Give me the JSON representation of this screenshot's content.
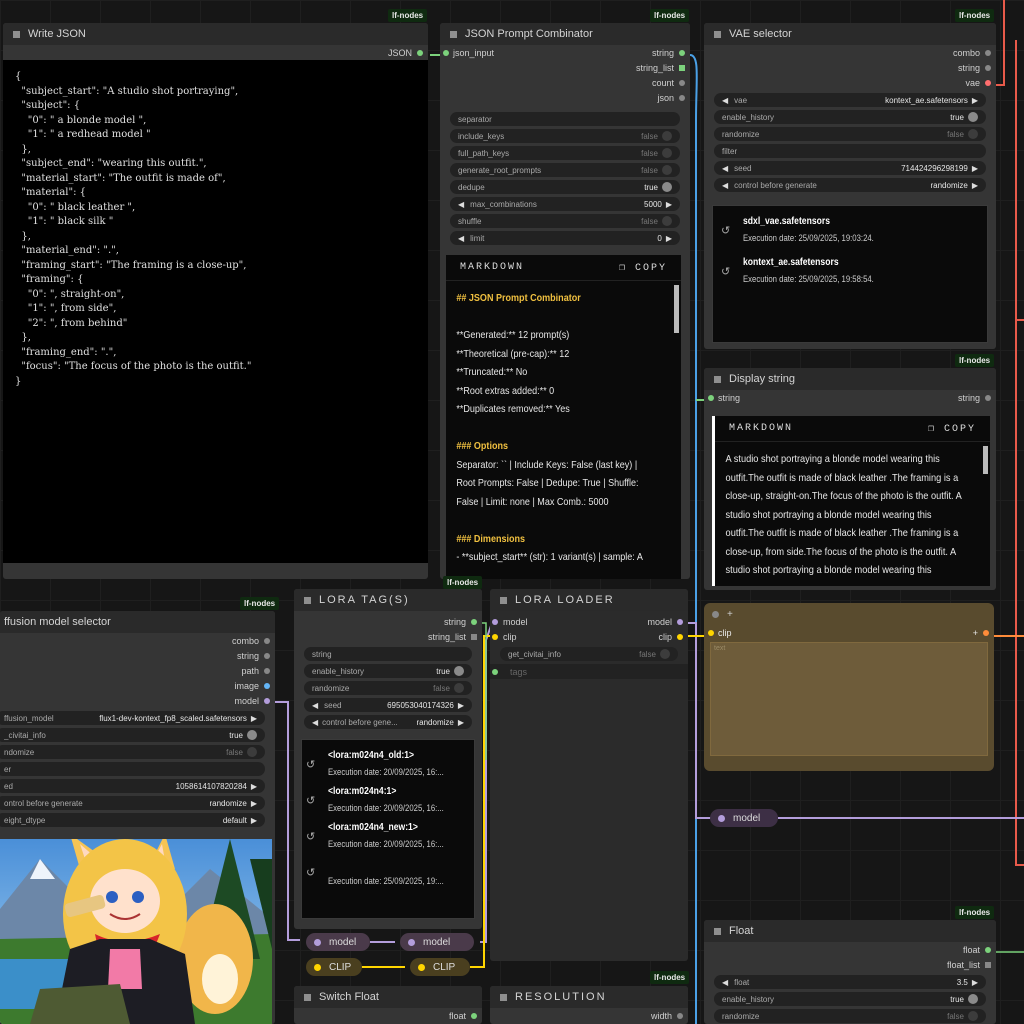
{
  "badge": "lf-nodes",
  "write_json": {
    "title": "Write JSON",
    "output": "JSON",
    "code": "{\n  \"subject_start\": \"A studio shot portraying\",\n  \"subject\": {\n    \"0\": \" a blonde model \",\n    \"1\": \" a redhead model \"\n  },\n  \"subject_end\": \"wearing this outfit.\",\n  \"material_start\": \"The outfit is made of\",\n  \"material\": {\n    \"0\": \" black leather \",\n    \"1\": \" black silk \"\n  },\n  \"material_end\": \".\",\n  \"framing_start\": \"The framing is a close-up\",\n  \"framing\": {\n    \"0\": \", straight-on\",\n    \"1\": \", from side\",\n    \"2\": \", from behind\"\n  },\n  \"framing_end\": \".\",\n  \"focus\": \"The focus of the photo is the outfit.\"\n}"
  },
  "combinator": {
    "title": "JSON Prompt Combinator",
    "input": "json_input",
    "outputs": [
      "string",
      "string_list",
      "count",
      "json"
    ],
    "widgets": [
      {
        "label": "separator",
        "value": ""
      },
      {
        "label": "include_keys",
        "value": "false"
      },
      {
        "label": "full_path_keys",
        "value": "false"
      },
      {
        "label": "generate_root_prompts",
        "value": "false"
      },
      {
        "label": "dedupe",
        "value": "true"
      },
      {
        "label": "max_combinations",
        "value": "5000"
      },
      {
        "label": "shuffle",
        "value": "false"
      },
      {
        "label": "limit",
        "value": "0"
      }
    ],
    "md_label": "MARKDOWN",
    "copy": "COPY",
    "md_lines": [
      "## JSON Prompt Combinator",
      "",
      "**Generated:** 12 prompt(s)",
      "**Theoretical (pre-cap):** 12",
      "**Truncated:** No",
      "**Root extras added:** 0",
      "**Duplicates removed:** Yes",
      "",
      "### Options",
      "Separator: `` | Include Keys: False (last key) |",
      "Root Prompts: False | Dedupe: True | Shuffle:",
      "False | Limit: none | Max Comb.: 5000",
      "",
      "### Dimensions",
      "- **subject_start** (str): 1 variant(s) | sample: A"
    ]
  },
  "vae": {
    "title": "VAE selector",
    "outputs": [
      "combo",
      "string",
      "vae"
    ],
    "widgets": [
      {
        "label": "vae",
        "value": "kontext_ae.safetensors"
      },
      {
        "label": "enable_history",
        "value": "true"
      },
      {
        "label": "randomize",
        "value": "false"
      },
      {
        "label": "filter",
        "value": ""
      },
      {
        "label": "seed",
        "value": "714424296298199"
      },
      {
        "label": "control before generate",
        "value": "randomize"
      }
    ],
    "history": [
      {
        "name": "sdxl_vae.safetensors",
        "date": "Execution date: 25/09/2025, 19:03:24."
      },
      {
        "name": "kontext_ae.safetensors",
        "date": "Execution date: 25/09/2025, 19:58:54."
      }
    ]
  },
  "display": {
    "title": "Display string",
    "input": "string",
    "output": "string",
    "md_label": "MARKDOWN",
    "copy": "COPY",
    "text": "A studio shot portraying a blonde model wearing this outfit.The outfit is made of black leather .The framing is a close-up, straight-on.The focus of the photo is the outfit. A studio shot portraying a blonde model wearing this outfit.The outfit is made of black leather .The framing is a close-up, from side.The focus of the photo is the outfit. A studio shot portraying a blonde model wearing this"
  },
  "diffusion": {
    "title": "ffusion model selector",
    "outputs": [
      "combo",
      "string",
      "path",
      "image",
      "model"
    ],
    "widgets": [
      {
        "label": "ffusion_model",
        "value": "flux1-dev-kontext_fp8_scaled.safetensors"
      },
      {
        "label": "_civitai_info",
        "value": "true"
      },
      {
        "label": "ndomize",
        "value": "false"
      },
      {
        "label": "er",
        "value": ""
      },
      {
        "label": "ed",
        "value": "1058614107820284"
      },
      {
        "label": "ontrol before generate",
        "value": "randomize"
      },
      {
        "label": "eight_dtype",
        "value": "default"
      }
    ]
  },
  "lora_tags": {
    "title": "LORA TAG(S)",
    "outputs": [
      "string",
      "string_list"
    ],
    "widgets": [
      {
        "label": "string",
        "value": ""
      },
      {
        "label": "enable_history",
        "value": "true"
      },
      {
        "label": "randomize",
        "value": "false"
      },
      {
        "label": "seed",
        "value": "695053040174326"
      },
      {
        "label": "control before gene...",
        "value": "randomize"
      }
    ],
    "history": [
      {
        "name": "<lora:m024n4_old:1>",
        "date": "Execution date: 20/09/2025, 16:..."
      },
      {
        "name": "<lora:m024n4:1>",
        "date": "Execution date: 20/09/2025, 16:..."
      },
      {
        "name": "<lora:m024n4_new:1>",
        "date": "Execution date: 20/09/2025, 16:..."
      },
      {
        "name": "",
        "date": "Execution date: 25/09/2025, 19:..."
      }
    ]
  },
  "lora_loader": {
    "title": "LORA LOADER",
    "inputs": [
      "model",
      "clip",
      "tags"
    ],
    "outputs": [
      "model",
      "clip"
    ],
    "widget": {
      "label": "get_civitai_info",
      "value": "false"
    }
  },
  "clip_group": {
    "plus": "+",
    "input": "clip",
    "text_placeholder": "text"
  },
  "reroutes": {
    "model": "model",
    "clip": "CLIP"
  },
  "float_node": {
    "title": "Float",
    "outputs": [
      "float",
      "float_list"
    ],
    "widgets": [
      {
        "label": "float",
        "value": "3.5"
      },
      {
        "label": "enable_history",
        "value": "true"
      },
      {
        "label": "randomize",
        "value": "false"
      }
    ]
  },
  "switch_float": {
    "title": "Switch Float",
    "output": "float"
  },
  "resolution": {
    "title": "RESOLUTION",
    "output": "width"
  },
  "colors": {
    "model": "#b39ddb",
    "clip": "#ffd500",
    "vae": "#ff6e6e",
    "string": "#7cd27c",
    "link_red": "#e85a4a",
    "link_blue": "#4aa0e6"
  }
}
